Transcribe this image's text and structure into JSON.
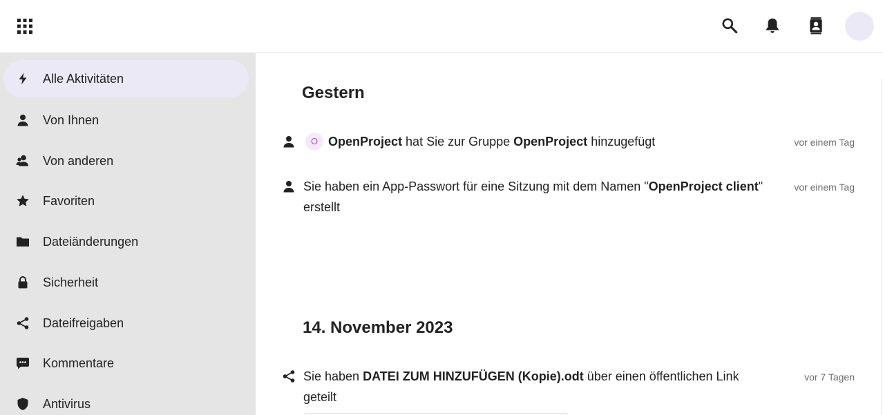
{
  "header": {
    "app_menu_icon": "grid-icon",
    "search_icon": "search-icon",
    "notifications_icon": "bell-icon",
    "contacts_icon": "contacts-icon"
  },
  "sidebar": {
    "items": [
      {
        "label": "Alle Aktivitäten",
        "icon": "lightning-icon",
        "active": true
      },
      {
        "label": "Von Ihnen",
        "icon": "person-icon"
      },
      {
        "label": "Von anderen",
        "icon": "people-icon"
      },
      {
        "label": "Favoriten",
        "icon": "star-icon"
      },
      {
        "label": "Dateiänderungen",
        "icon": "folder-icon"
      },
      {
        "label": "Sicherheit",
        "icon": "lock-icon"
      },
      {
        "label": "Dateifreigaben",
        "icon": "share-icon"
      },
      {
        "label": "Kommentare",
        "icon": "comment-icon"
      },
      {
        "label": "Antivirus",
        "icon": "shield-icon"
      }
    ]
  },
  "main": {
    "sections": [
      {
        "title": "Gestern",
        "activities": [
          {
            "avatar_initial": "O",
            "actor": "OpenProject",
            "text_1": "hat Sie zur Gruppe",
            "group": "OpenProject",
            "text_2": "hinzugefügt",
            "time": "vor einem Tag"
          },
          {
            "text_1": "Sie haben ein App-Passwort für eine Sitzung mit dem Namen \"",
            "name": "OpenProject client",
            "text_2": "\"",
            "text_3": "erstellt",
            "time": "vor einem Tag"
          }
        ]
      },
      {
        "title": "14. November 2023",
        "activities": [
          {
            "text_1": "Sie haben",
            "file": "DATEI ZUM HINZUFÜGEN (Kopie).odt",
            "text_2": "über einen öffentlichen Link",
            "text_3": "geteilt",
            "time": "vor 7 Tagen"
          }
        ]
      }
    ]
  },
  "colors": {
    "active_bg": "#ece9f7",
    "sidebar_bg": "#e5e5e5",
    "avatar_text": "#9b59b6"
  }
}
